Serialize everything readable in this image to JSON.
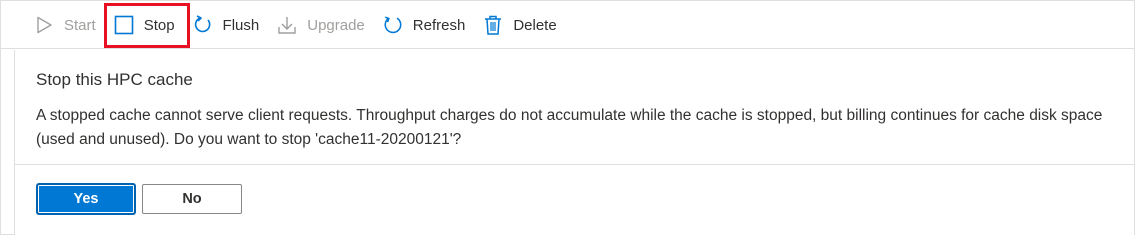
{
  "toolbar": {
    "items": [
      {
        "label": "Start",
        "icon": "play-icon",
        "enabled": false
      },
      {
        "label": "Stop",
        "icon": "stop-icon",
        "enabled": true
      },
      {
        "label": "Flush",
        "icon": "flush-icon",
        "enabled": true
      },
      {
        "label": "Upgrade",
        "icon": "download-icon",
        "enabled": false
      },
      {
        "label": "Refresh",
        "icon": "refresh-icon",
        "enabled": true
      },
      {
        "label": "Delete",
        "icon": "trash-icon",
        "enabled": true
      }
    ]
  },
  "dialog": {
    "title": "Stop this HPC cache",
    "message": "A stopped cache cannot serve client requests. Throughput charges do not accumulate while the cache is stopped, but billing continues for cache disk space (used and unused). Do you want to stop 'cache11-20200121'?",
    "yes_label": "Yes",
    "no_label": "No"
  },
  "colors": {
    "accent": "#0078d4",
    "highlight": "#e81123",
    "disabled": "#a19f9d",
    "text": "#323130"
  }
}
